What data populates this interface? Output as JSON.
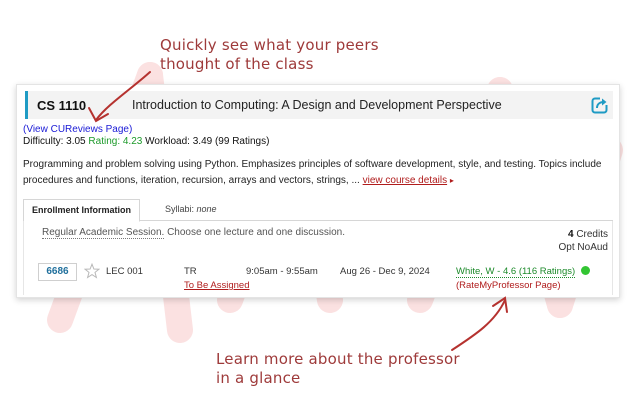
{
  "annotations": {
    "top_line1": "Quickly see what your peers",
    "top_line2": "thought of the class",
    "bottom_line1": "Learn more about the professor",
    "bottom_line2": "in a glance"
  },
  "colors": {
    "accent_annotation": "#9e3a3a",
    "header_accent": "#1f9bc4",
    "link_blue": "#1a1ad6",
    "rating_green": "#1c9a2a",
    "link_red": "#b01c1c",
    "status_open": "#33c533"
  },
  "course": {
    "code": "CS 1110",
    "title": "Introduction to Computing: A Design and Development Perspective",
    "share_icon": "share-arrow-icon",
    "cureviews_link": "(View CUReviews Page)",
    "difficulty_label": "Difficulty: 3.05",
    "rating_label": "Rating: 4.23",
    "workload_label": "Workload: 3.49 (99 Ratings)",
    "description": "Programming and problem solving using Python. Emphasizes principles of software development, style, and testing. Topics include procedures and functions, iteration, recursion, arrays and vectors, strings, ... ",
    "details_link": "view course details",
    "details_arrow": "▸"
  },
  "tabs": {
    "enrollment": "Enrollment Information",
    "syllabi_label": "Syllabi:",
    "syllabi_value": "none"
  },
  "enrollment": {
    "session_name": "Regular Academic Session.",
    "session_note": "Choose one lecture and one discussion.",
    "credits_value": "4",
    "credits_label": "Credits",
    "grading": "Opt NoAud"
  },
  "section": {
    "class_number": "6686",
    "star_icon": "star-outline-icon",
    "section_name": "LEC 001",
    "days": "TR",
    "location": "To Be Assigned",
    "time": "9:05am - 9:55am",
    "dates": "Aug 26 - Dec 9, 2024",
    "instructor_rating": "White, W - 4.6 (116 Ratings)",
    "rmp_link": "(RateMyProfessor Page)",
    "status": "open"
  }
}
